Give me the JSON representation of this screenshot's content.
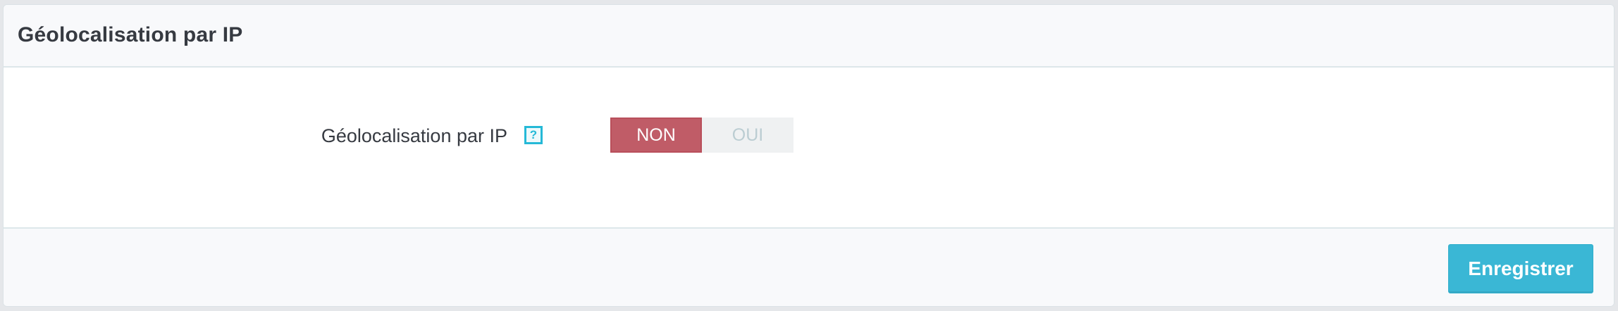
{
  "panel": {
    "title": "Géolocalisation par IP"
  },
  "form": {
    "field_label": "Géolocalisation par IP",
    "help_icon": "?",
    "switch": {
      "off_label": "NON",
      "on_label": "OUI",
      "selected": "NON"
    }
  },
  "footer": {
    "save_label": "Enregistrer"
  },
  "colors": {
    "accent": "#25b9d7",
    "switch_off_active": "#c05c67",
    "save_button": "#3ab7d5"
  }
}
